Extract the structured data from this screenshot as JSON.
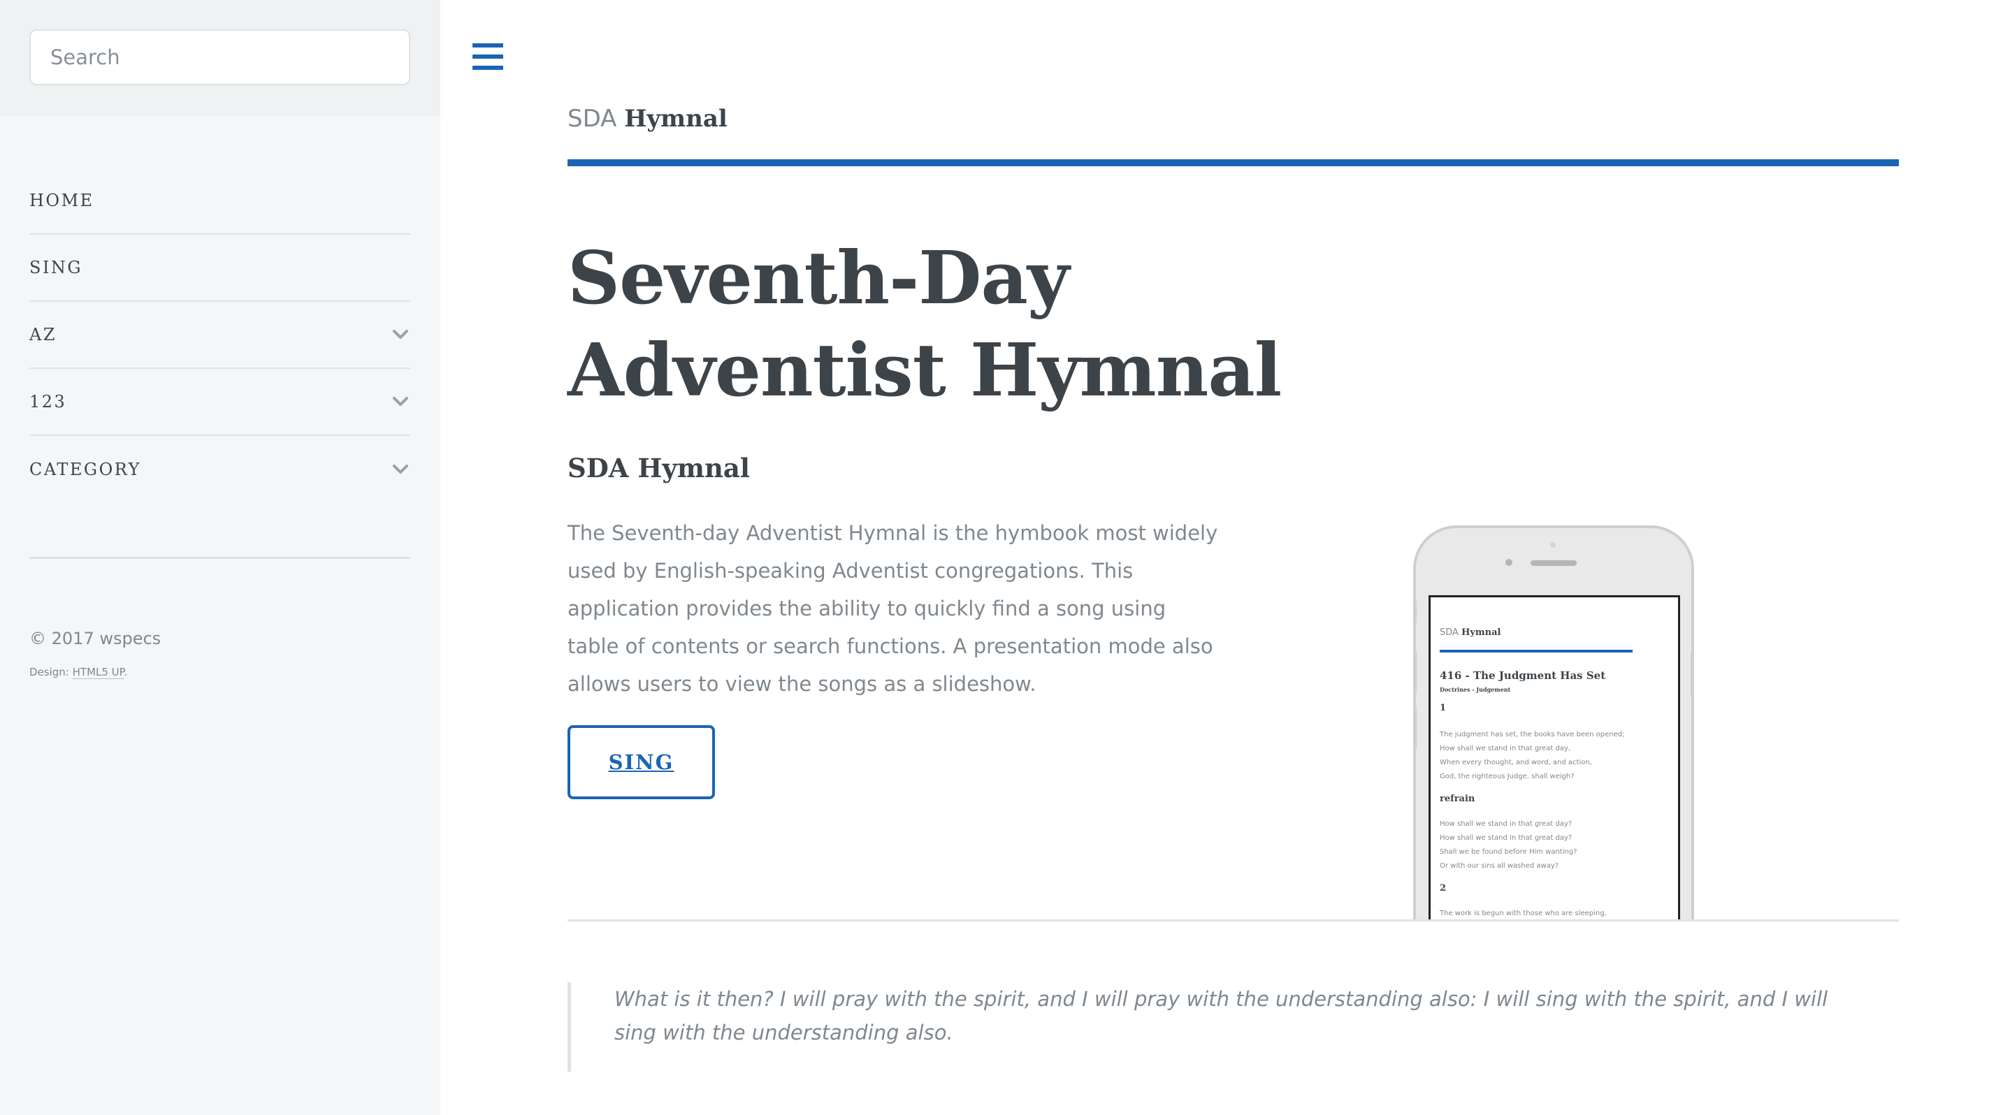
{
  "sidebar": {
    "search": {
      "placeholder": "Search"
    },
    "items": [
      {
        "label": "HOME",
        "has_dropdown": false
      },
      {
        "label": "SING",
        "has_dropdown": false
      },
      {
        "label": "AZ",
        "has_dropdown": true
      },
      {
        "label": "123",
        "has_dropdown": true
      },
      {
        "label": "CATEGORY",
        "has_dropdown": true
      }
    ],
    "footer": {
      "copyright": "© 2017 wspecs",
      "design_prefix": "Design: ",
      "design_link": "HTML5 UP",
      "design_suffix": "."
    }
  },
  "header": {
    "brand_light": "SDA",
    "brand_bold": "Hymnal"
  },
  "hero": {
    "title": "Seventh-Day Adventist Hymnal",
    "subtitle": "SDA Hymnal",
    "description": "The Seventh-day Adventist Hymnal is the hymbook most widely used by English-speaking Adventist congregations. This application provides the ability to quickly find a song using table of contents or search functions. A presentation mode also allows users to view the songs as a slideshow.",
    "button_label": "SING"
  },
  "phone_preview": {
    "brand_light": "SDA",
    "brand_bold": "Hymnal",
    "song_title": "416 - The Judgment Has Set",
    "category": "Doctrines - Judgement",
    "verse1_number": "1",
    "verse1_lines": [
      "The judgment has set, the books have been opened;",
      "How shall we stand in that great day,",
      "When every thought, and word, and action,",
      "God, the righteous Judge, shall weigh?"
    ],
    "refrain_label": "refrain",
    "refrain_lines": [
      "How shall we stand in that great day?",
      "How shall we stand in that great day?",
      "Shall we be found before Him wanting?",
      "Or with our sins all washed away?"
    ],
    "verse2_number": "2",
    "verse2_lines": [
      "The work is begun with those who are sleeping,"
    ]
  },
  "quote": {
    "text": "What is it then? I will pray with the spirit, and I will pray with the understanding also: I will sing with the spirit, and I will sing with the understanding also."
  },
  "colors": {
    "accent": "#1a64b6",
    "text": "#3d4449",
    "muted": "#7f888f",
    "sidebar_bg": "#f5f6f7",
    "divider": "#dfe2e5"
  },
  "icons": {
    "menu": "hamburger-menu-icon",
    "dropdown": "chevron-down-icon"
  }
}
